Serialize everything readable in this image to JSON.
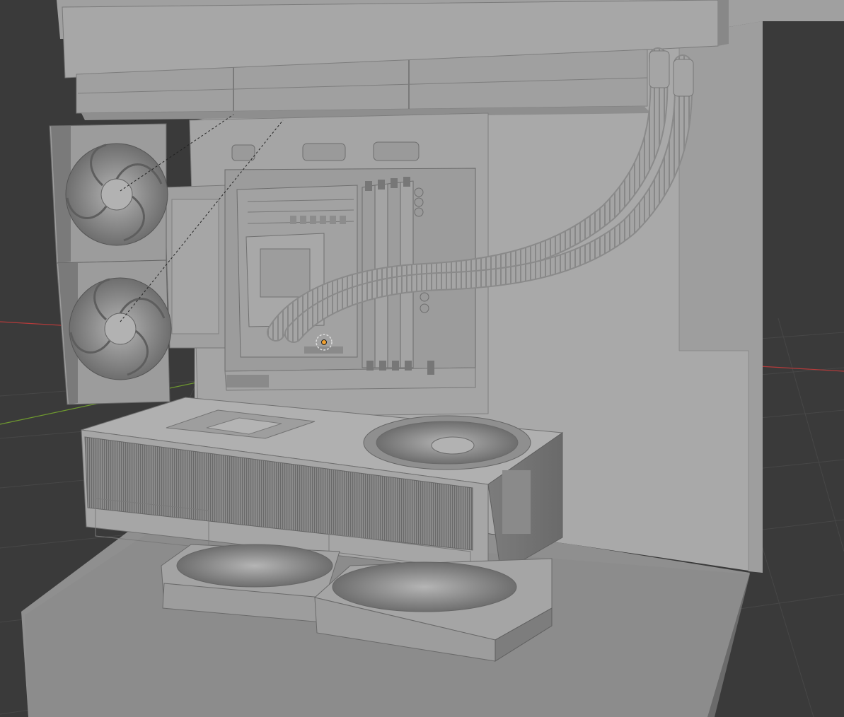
{
  "viewport": {
    "mode": "3d-viewport",
    "shading": "solid",
    "background_color": "#3a3a3a",
    "grid_color": "#474747",
    "x_axis_color": "#b43a3a",
    "y_axis_color": "#6f9a2f",
    "object_color": "#a3a3a3",
    "object_shadow_color": "#6d6d6d",
    "origin_color": "#f0a030"
  },
  "scene_objects": [
    "pc-case",
    "aio-radiator",
    "radiator-fans",
    "front-fans",
    "motherboard",
    "ram-sticks",
    "cpu-block",
    "aio-tubes",
    "gpu",
    "bottom-fans"
  ]
}
